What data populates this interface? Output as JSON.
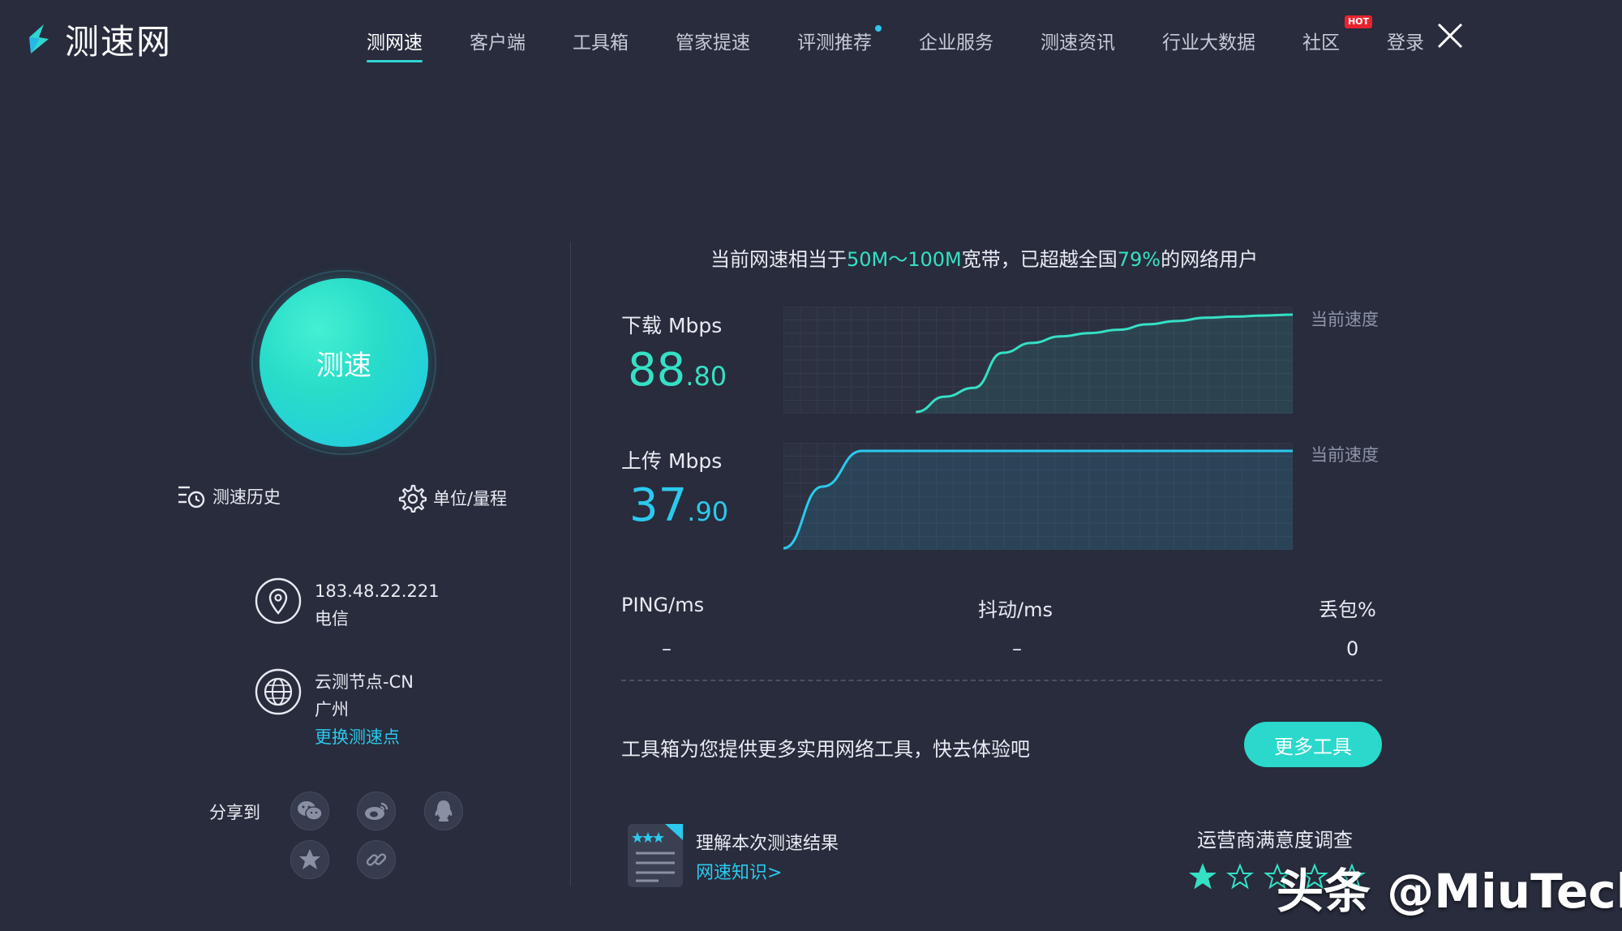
{
  "header": {
    "logo_text": "测速网",
    "nav": [
      {
        "label": "测网速",
        "active": true
      },
      {
        "label": "客户端"
      },
      {
        "label": "工具箱"
      },
      {
        "label": "管家提速"
      },
      {
        "label": "评测推荐",
        "dot": true
      },
      {
        "label": "企业服务"
      },
      {
        "label": "测速资讯"
      },
      {
        "label": "行业大数据"
      },
      {
        "label": "社区",
        "badge": "HOT"
      },
      {
        "label": "登录"
      }
    ],
    "close_icon": "close-icon"
  },
  "left": {
    "speed_button": "测速",
    "history_label": "测速历史",
    "units_label": "单位/量程",
    "ip": "183.48.22.221",
    "isp": "电信",
    "node": "云测节点-CN",
    "city": "广州",
    "change_node": "更换测速点",
    "share_label": "分享到",
    "share_icons": [
      "wechat-icon",
      "weibo-icon",
      "qq-icon",
      "qzone-icon",
      "link-icon"
    ]
  },
  "summary": {
    "prefix": "当前网速相当于",
    "bandwidth": "50M～100M",
    "middle": "宽带，已超越全国",
    "percent": "79%",
    "suffix": "的网络用户"
  },
  "download": {
    "label": "下载",
    "unit": "Mbps",
    "int_part": "88",
    "dec_part": ".80",
    "current_label": "当前速度"
  },
  "upload": {
    "label": "上传",
    "unit": "Mbps",
    "int_part": "37",
    "dec_part": ".90",
    "current_label": "当前速度"
  },
  "stats": {
    "ping_label": "PING/ms",
    "ping_value": "–",
    "jitter_label": "抖动/ms",
    "jitter_value": "–",
    "loss_label": "丢包%",
    "loss_value": "0"
  },
  "tools": {
    "text": "工具箱为您提供更多实用网络工具，快去体验吧",
    "button": "更多工具"
  },
  "knowledge": {
    "title": "理解本次测速结果",
    "link": "网速知识>"
  },
  "survey": {
    "title": "运营商满意度调查",
    "rating": 1,
    "max": 5
  },
  "watermark": "头条 @MiuTech",
  "colors": {
    "background": "#282c3c",
    "accent_green": "#35e0c5",
    "accent_blue": "#2cc9ee",
    "hot_badge": "#e8232f"
  },
  "chart_data": [
    {
      "type": "area",
      "series": [
        {
          "name": "下载",
          "values": [
            0,
            14,
            22,
            54,
            63,
            69,
            72,
            75,
            80,
            83,
            86,
            87,
            88,
            88.8
          ]
        }
      ]
    },
    {
      "type": "area",
      "series": [
        {
          "name": "上传",
          "values": [
            0,
            24,
            37.9,
            37.9,
            37.9,
            37.9,
            37.9,
            37.9,
            37.9,
            37.9,
            37.9,
            37.9,
            37.9,
            37.9
          ]
        }
      ]
    }
  ]
}
